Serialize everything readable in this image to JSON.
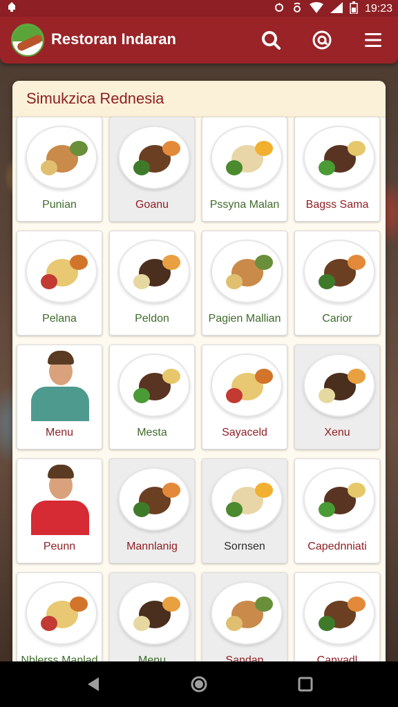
{
  "status": {
    "time": "19:23"
  },
  "app": {
    "title": "Restoran Indaran"
  },
  "card": {
    "title": "Simukzica Rednesia"
  },
  "colors": {
    "primary": "#9a2328",
    "accent_green": "#5aa43a"
  },
  "items": [
    {
      "label": "Punian",
      "type": "food",
      "style": "green"
    },
    {
      "label": "Goanu",
      "type": "food",
      "style": "red"
    },
    {
      "label": "Pssyna Malan",
      "type": "food",
      "style": "green"
    },
    {
      "label": "Bagss Sama",
      "type": "food",
      "style": "red"
    },
    {
      "label": "Pelana",
      "type": "food",
      "style": "green"
    },
    {
      "label": "Peldon",
      "type": "food",
      "style": "green"
    },
    {
      "label": "Pagien Mallian",
      "type": "food",
      "style": "green"
    },
    {
      "label": "Carior",
      "type": "food",
      "style": "green"
    },
    {
      "label": "Menu",
      "type": "person",
      "style": "red"
    },
    {
      "label": "Mesta",
      "type": "food",
      "style": "green"
    },
    {
      "label": "Sayaceld",
      "type": "food",
      "style": "red"
    },
    {
      "label": "Xenu",
      "type": "food",
      "style": "red"
    },
    {
      "label": "Peunn",
      "type": "person",
      "style": "red"
    },
    {
      "label": "Mannlanig",
      "type": "food",
      "style": "red"
    },
    {
      "label": "Sornsen",
      "type": "food",
      "style": "dark"
    },
    {
      "label": "Capednniati",
      "type": "food",
      "style": "red"
    },
    {
      "label": "Nblerss Manlad",
      "type": "food",
      "style": "green"
    },
    {
      "label": "Menu",
      "type": "food",
      "style": "green"
    },
    {
      "label": "Sandan",
      "type": "food",
      "style": "red"
    },
    {
      "label": "Canyadl",
      "type": "food",
      "style": "red"
    }
  ],
  "icons": {
    "appbar": [
      "search-icon",
      "at-sign-icon",
      "menu-icon"
    ],
    "navbar": [
      "back-icon",
      "home-icon",
      "recents-icon"
    ]
  }
}
